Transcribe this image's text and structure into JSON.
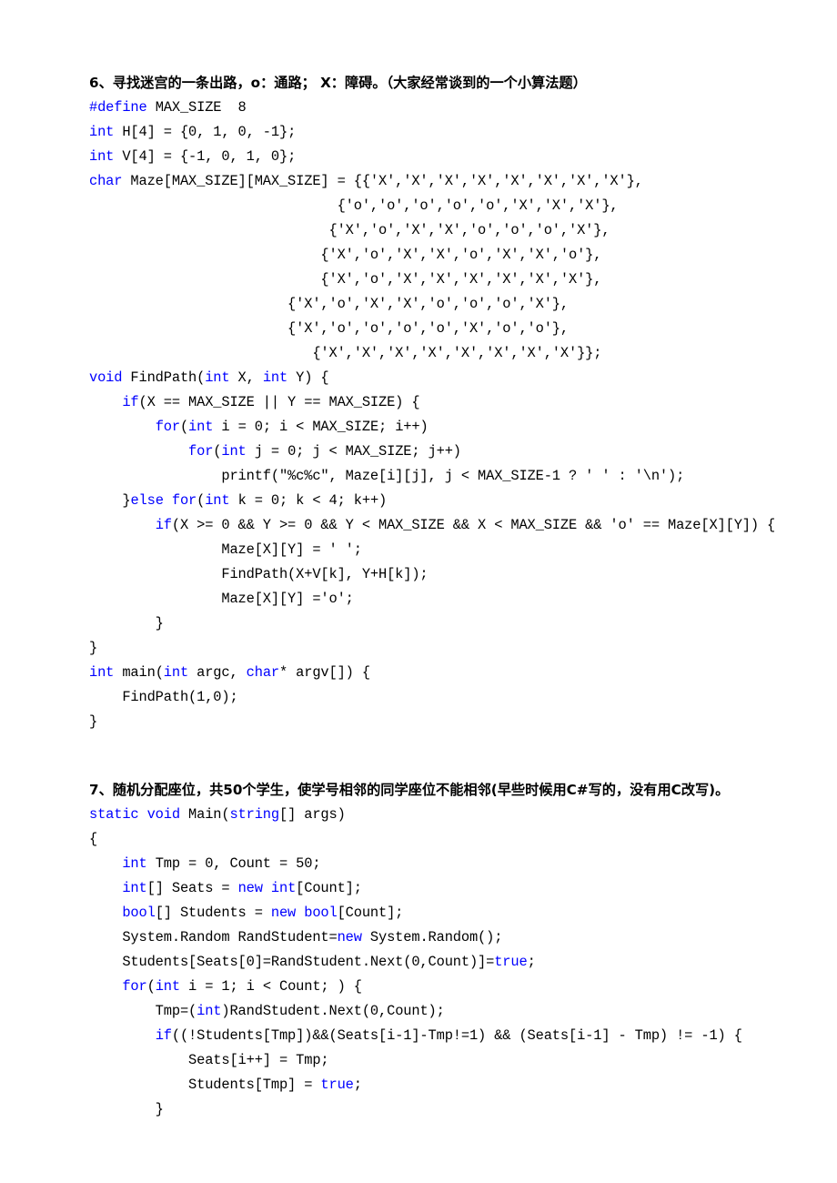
{
  "document": {
    "section6": {
      "heading": "6、寻找迷宫的一条出路，o：通路； X：障碍。（大家经常谈到的一个小算法题）",
      "language": "C",
      "code_lines": [
        [
          {
            "t": "#define",
            "c": "kw"
          },
          {
            "t": " MAX_SIZE  8",
            "c": "blk"
          }
        ],
        [
          {
            "t": "int",
            "c": "kw"
          },
          {
            "t": " H[4] = {0, 1, 0, -1};",
            "c": "blk"
          }
        ],
        [
          {
            "t": "int",
            "c": "kw"
          },
          {
            "t": " V[4] = {-1, 0, 1, 0};",
            "c": "blk"
          }
        ],
        [
          {
            "t": "char",
            "c": "kw"
          },
          {
            "t": " Maze[MAX_SIZE][MAX_SIZE] = {{'X','X','X','X','X','X','X','X'},",
            "c": "blk"
          }
        ],
        [
          {
            "t": "                              {'o','o','o','o','o','X','X','X'},",
            "c": "blk"
          }
        ],
        [
          {
            "t": "                             {'X','o','X','X','o','o','o','X'},",
            "c": "blk"
          }
        ],
        [
          {
            "t": "                            {'X','o','X','X','o','X','X','o'},",
            "c": "blk"
          }
        ],
        [
          {
            "t": "                            {'X','o','X','X','X','X','X','X'},",
            "c": "blk"
          }
        ],
        [
          {
            "t": "                        {'X','o','X','X','o','o','o','X'},",
            "c": "blk"
          }
        ],
        [
          {
            "t": "                        {'X','o','o','o','o','X','o','o'},",
            "c": "blk"
          }
        ],
        [
          {
            "t": "                           {'X','X','X','X','X','X','X','X'}};",
            "c": "blk"
          }
        ],
        [
          {
            "t": "void",
            "c": "kw"
          },
          {
            "t": " FindPath(",
            "c": "blk"
          },
          {
            "t": "int",
            "c": "kw"
          },
          {
            "t": " X, ",
            "c": "blk"
          },
          {
            "t": "int",
            "c": "kw"
          },
          {
            "t": " Y) {",
            "c": "blk"
          }
        ],
        [
          {
            "t": "    ",
            "c": "blk"
          },
          {
            "t": "if",
            "c": "kw"
          },
          {
            "t": "(X == MAX_SIZE || Y == MAX_SIZE) {",
            "c": "blk"
          }
        ],
        [
          {
            "t": "        ",
            "c": "blk"
          },
          {
            "t": "for",
            "c": "kw"
          },
          {
            "t": "(",
            "c": "blk"
          },
          {
            "t": "int",
            "c": "kw"
          },
          {
            "t": " i = 0; i < MAX_SIZE; i++)",
            "c": "blk"
          }
        ],
        [
          {
            "t": "            ",
            "c": "blk"
          },
          {
            "t": "for",
            "c": "kw"
          },
          {
            "t": "(",
            "c": "blk"
          },
          {
            "t": "int",
            "c": "kw"
          },
          {
            "t": " j = 0; j < MAX_SIZE; j++)",
            "c": "blk"
          }
        ],
        [
          {
            "t": "                printf(\"%c%c\", Maze[i][j], j < MAX_SIZE-1 ? ' ' : '\\n');",
            "c": "blk"
          }
        ],
        [
          {
            "t": "    }",
            "c": "blk"
          },
          {
            "t": "else for",
            "c": "kw"
          },
          {
            "t": "(",
            "c": "blk"
          },
          {
            "t": "int",
            "c": "kw"
          },
          {
            "t": " k = 0; k < 4; k++)",
            "c": "blk"
          }
        ],
        [
          {
            "t": "        ",
            "c": "blk"
          },
          {
            "t": "if",
            "c": "kw"
          },
          {
            "t": "(X >= 0 && Y >= 0 && Y < MAX_SIZE && X < MAX_SIZE && 'o' == Maze[X][Y]) {",
            "c": "blk"
          }
        ],
        [
          {
            "t": "                Maze[X][Y] = ' ';",
            "c": "blk"
          }
        ],
        [
          {
            "t": "                FindPath(X+V[k], Y+H[k]);",
            "c": "blk"
          }
        ],
        [
          {
            "t": "                Maze[X][Y] ='o';",
            "c": "blk"
          }
        ],
        [
          {
            "t": "        }",
            "c": "blk"
          }
        ],
        [
          {
            "t": "}",
            "c": "blk"
          }
        ],
        [
          {
            "t": "int",
            "c": "kw"
          },
          {
            "t": " main(",
            "c": "blk"
          },
          {
            "t": "int",
            "c": "kw"
          },
          {
            "t": " argc, ",
            "c": "blk"
          },
          {
            "t": "char",
            "c": "kw"
          },
          {
            "t": "* argv[]) {",
            "c": "blk"
          }
        ],
        [
          {
            "t": "    FindPath(1,0);",
            "c": "blk"
          }
        ],
        [
          {
            "t": "}",
            "c": "blk"
          }
        ]
      ]
    },
    "section7": {
      "heading": "7、随机分配座位，共50个学生，使学号相邻的同学座位不能相邻(早些时候用C#写的，没有用C改写)。",
      "language": "C#",
      "code_lines": [
        [
          {
            "t": "static void",
            "c": "kw"
          },
          {
            "t": " Main(",
            "c": "blk"
          },
          {
            "t": "string",
            "c": "kw"
          },
          {
            "t": "[] args",
            "c": "blk"
          },
          {
            "t": ")",
            "c": "blk"
          }
        ],
        [
          {
            "t": "{",
            "c": "blk"
          }
        ],
        [
          {
            "t": "    ",
            "c": "blk"
          },
          {
            "t": "int",
            "c": "kw"
          },
          {
            "t": " Tmp = 0, Count = 50;",
            "c": "blk"
          }
        ],
        [
          {
            "t": "    ",
            "c": "blk"
          },
          {
            "t": "int",
            "c": "kw"
          },
          {
            "t": "[] Seats = ",
            "c": "blk"
          },
          {
            "t": "new int",
            "c": "kw"
          },
          {
            "t": "[Count];",
            "c": "blk"
          }
        ],
        [
          {
            "t": "    ",
            "c": "blk"
          },
          {
            "t": "bool",
            "c": "kw"
          },
          {
            "t": "[] Students = ",
            "c": "blk"
          },
          {
            "t": "new bool",
            "c": "kw"
          },
          {
            "t": "[Count];",
            "c": "blk"
          }
        ],
        [
          {
            "t": "    System.Random RandStudent=",
            "c": "blk"
          },
          {
            "t": "new",
            "c": "kw"
          },
          {
            "t": " System.Random();",
            "c": "blk"
          }
        ],
        [
          {
            "t": "    Students[Seats[0]=RandStudent.Next(0,Count)]=",
            "c": "blk"
          },
          {
            "t": "true",
            "c": "kw"
          },
          {
            "t": ";",
            "c": "blk"
          }
        ],
        [
          {
            "t": "    ",
            "c": "blk"
          },
          {
            "t": "for",
            "c": "kw"
          },
          {
            "t": "(",
            "c": "blk"
          },
          {
            "t": "int",
            "c": "kw"
          },
          {
            "t": " i = 1; i < Count; ) {",
            "c": "blk"
          }
        ],
        [
          {
            "t": "        Tmp=(",
            "c": "blk"
          },
          {
            "t": "int",
            "c": "kw"
          },
          {
            "t": ")RandStudent.Next(0,Count);",
            "c": "blk"
          }
        ],
        [
          {
            "t": "        ",
            "c": "blk"
          },
          {
            "t": "if",
            "c": "kw"
          },
          {
            "t": "((!Students[Tmp])&&(Seats[i-1]-Tmp!=1) && (Seats[i-1] - Tmp) != -1) {",
            "c": "blk"
          }
        ],
        [
          {
            "t": "            Seats[i++] = Tmp;",
            "c": "blk"
          }
        ],
        [
          {
            "t": "            Students[Tmp] = ",
            "c": "blk"
          },
          {
            "t": "true",
            "c": "kw"
          },
          {
            "t": ";",
            "c": "blk"
          }
        ],
        [
          {
            "t": "        }",
            "c": "blk"
          }
        ]
      ]
    }
  },
  "colors": {
    "keyword": "#0000ff",
    "text": "#000000",
    "background": "#ffffff"
  }
}
